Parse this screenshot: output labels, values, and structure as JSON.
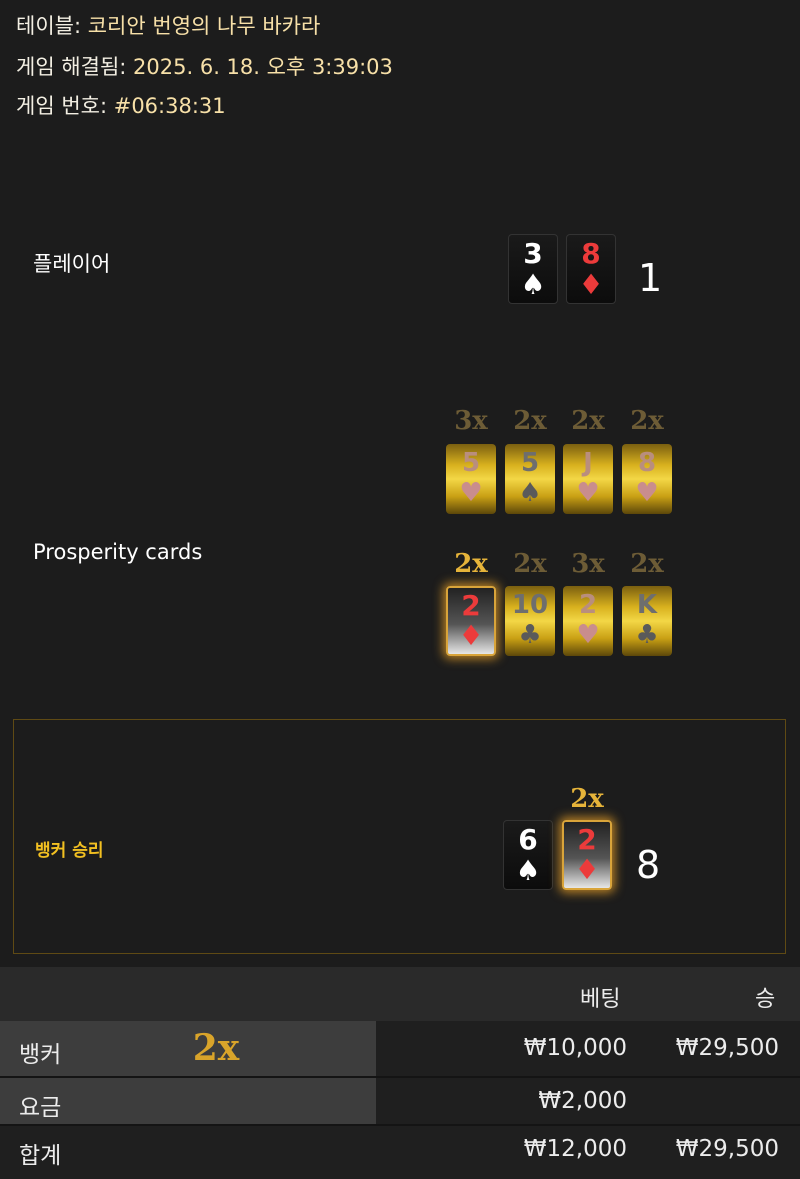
{
  "header": {
    "table_label": "테이블:",
    "table_value": "코리안 번영의 나무 바카라",
    "resolved_label": "게임 해결됨:",
    "resolved_value": "2025. 6. 18. 오후 3:39:03",
    "game_no_label": "게임 번호:",
    "game_no_value": "#06:38:31"
  },
  "player": {
    "label": "플레이어",
    "cards": [
      {
        "rank": "3",
        "suit": "♠",
        "color": "white"
      },
      {
        "rank": "8",
        "suit": "♦",
        "color": "red"
      }
    ],
    "score": "1"
  },
  "prosperity": {
    "label": "Prosperity cards",
    "row1": [
      {
        "mult": "3x",
        "rank": "5",
        "suit": "♥"
      },
      {
        "mult": "2x",
        "rank": "5",
        "suit": "♠"
      },
      {
        "mult": "2x",
        "rank": "J",
        "suit": "♥"
      },
      {
        "mult": "2x",
        "rank": "8",
        "suit": "♥"
      }
    ],
    "row2": [
      {
        "mult": "2x",
        "rank": "2",
        "suit": "♦",
        "highlighted": true
      },
      {
        "mult": "2x",
        "rank": "10",
        "suit": "♣"
      },
      {
        "mult": "3x",
        "rank": "2",
        "suit": "♥"
      },
      {
        "mult": "2x",
        "rank": "K",
        "suit": "♣"
      }
    ]
  },
  "banker": {
    "result_label": "뱅커 승리",
    "cards": [
      {
        "rank": "6",
        "suit": "♠",
        "color": "white"
      },
      {
        "rank": "2",
        "suit": "♦",
        "color": "red",
        "mult": "2x",
        "highlighted": true
      }
    ],
    "score": "8"
  },
  "bets_table": {
    "col_bet": "베팅",
    "col_win": "승",
    "rows": [
      {
        "label": "뱅커",
        "mult": "2x",
        "bet": "₩10,000",
        "win": "₩29,500"
      },
      {
        "label": "요금",
        "bet": "₩2,000",
        "win": ""
      }
    ],
    "total": {
      "label": "합계",
      "bet": "₩12,000",
      "win": "₩29,500"
    }
  },
  "colors": {
    "gold_accent": "#f2c021",
    "card_red": "#ec3b3b",
    "background": "#1c1c1c"
  }
}
